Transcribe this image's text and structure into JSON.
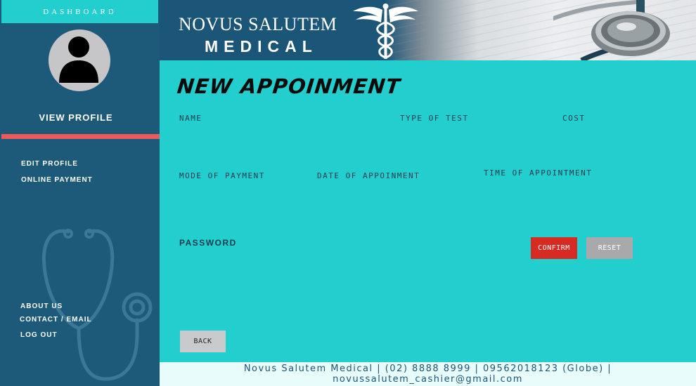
{
  "sidebar": {
    "dashboard_label": "DASHBOARD",
    "view_profile": "VIEW PROFILE",
    "links_top": [
      {
        "label": "EDIT PROFILE"
      },
      {
        "label": "ONLINE PAYMENT"
      }
    ],
    "links_bottom": [
      {
        "label": "ABOUT US"
      },
      {
        "label": "CONTACT / EMAIL"
      },
      {
        "label": "LOG OUT"
      }
    ]
  },
  "header": {
    "brand_line1": "NOVUS SALUTEM",
    "brand_line2": "MEDICAL"
  },
  "main": {
    "title": "NEW APPOINMENT",
    "fields": {
      "name": "NAME",
      "type_of_test": "TYPE OF TEST",
      "cost": "COST",
      "mode_of_payment": "MODE OF PAYMENT",
      "date_of_appointment": "DATE OF APPOINMENT",
      "time_of_appointment": "TIME OF APPOINTMENT",
      "password": "PASSWORD"
    },
    "buttons": {
      "confirm": "CONFIRM",
      "reset": "RESET",
      "back": "BACK"
    }
  },
  "footer": {
    "line1": "Novus Salutem Medical | (02) 8888 8999 | 09562018123 (Globe) |",
    "line2": "novussalutem_cashier@gmail.com"
  },
  "icons": {
    "avatar": "user-silhouette-icon",
    "caduceus": "caduceus-icon",
    "stethoscope": "stethoscope-icon"
  },
  "colors": {
    "sidebar_bg": "#1d5a79",
    "accent_teal": "#23cfce",
    "divider_red": "#eb5b57",
    "confirm_red": "#d72a23",
    "reset_gray": "#a9a9ab",
    "footer_bg": "#e9fcfc"
  }
}
